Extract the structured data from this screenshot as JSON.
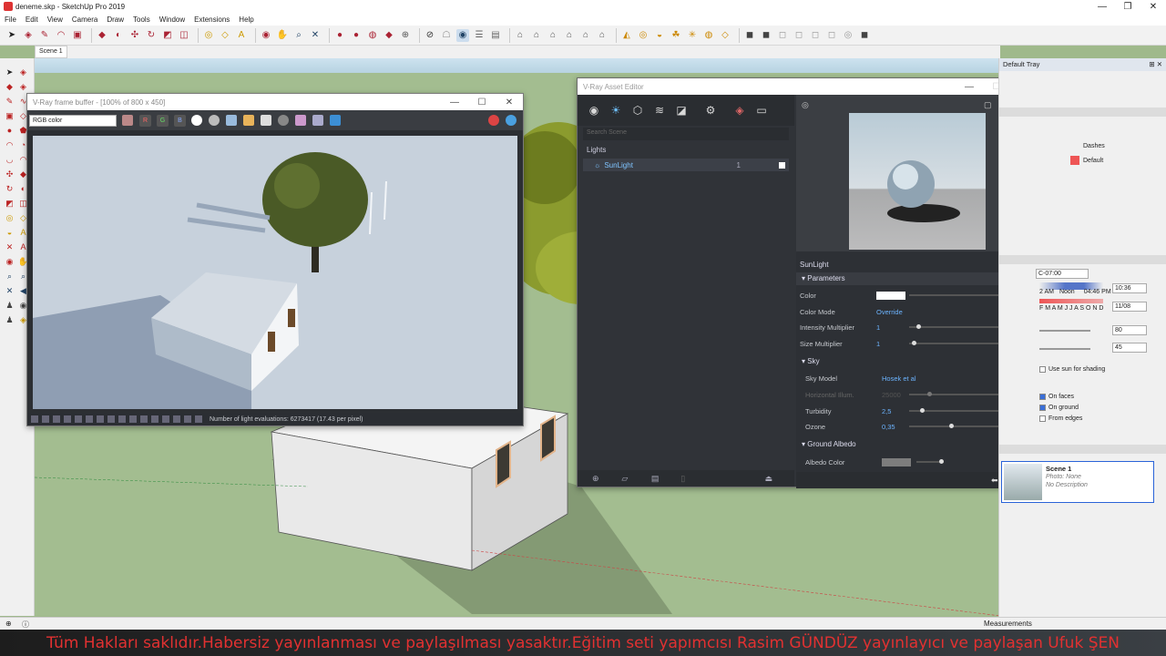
{
  "window": {
    "title": "deneme.skp - SketchUp Pro 2019",
    "min": "—",
    "max": "❐",
    "close": "✕"
  },
  "menu": [
    "File",
    "Edit",
    "View",
    "Camera",
    "Draw",
    "Tools",
    "Window",
    "Extensions",
    "Help"
  ],
  "scene_tab": "Scene 1",
  "vfb": {
    "title": "V-Ray frame buffer - [100% of 800 x 450]",
    "channel": "RGB color",
    "channels": [
      "R",
      "G",
      "B"
    ],
    "status": "Number of light evaluations: 6273417 (17.43 per pixel)"
  },
  "asset_editor": {
    "title": "V-Ray Asset Editor",
    "search_placeholder": "Search Scene",
    "list_header": "Lights",
    "light_name": "SunLight",
    "light_count": "1",
    "selected_name": "SunLight",
    "sections": {
      "parameters": "Parameters",
      "sky": "Sky",
      "ground_albedo": "Ground Albedo"
    },
    "params": {
      "color": "Color",
      "color_mode_label": "Color Mode",
      "color_mode": "Override",
      "intensity_label": "Intensity Multiplier",
      "intensity": "1",
      "size_label": "Size Multiplier",
      "size": "1",
      "sky_model_label": "Sky Model",
      "sky_model": "Hosek et al",
      "horizontal_illum_label": "Horizontal Illum.",
      "horizontal_illum": "25000",
      "turbidity_label": "Turbidity",
      "turbidity": "2,5",
      "ozone_label": "Ozone",
      "ozone": "0,35",
      "albedo_label": "Albedo Color"
    }
  },
  "tray": {
    "title": "Default Tray",
    "styles": {
      "dashes": "Dashes",
      "default": "Default"
    },
    "shadows": {
      "utc": "C-07:00",
      "time_left": "2 AM",
      "time_noon": "Noon",
      "time_right": "04:46 PM",
      "months": "F M A M J J A S O N D",
      "time_val": "10:36",
      "date_val": "11/08",
      "light_val": "80",
      "dark_val": "45",
      "use_sun": "Use sun for shading",
      "on_faces": "On faces",
      "on_ground": "On ground",
      "from_edges": "From edges"
    },
    "scene": {
      "name": "Scene 1",
      "photo": "Photo: None",
      "desc": "No Description"
    }
  },
  "status": {
    "measurements": "Measurements"
  },
  "caption": "Tüm Hakları saklıdır.Habersiz yayınlanması ve paylaşılması yasaktır.Eğitim seti yapımcısı Rasim GÜNDÜZ  yayınlayıcı ve paylaşan Ufuk ŞEN"
}
